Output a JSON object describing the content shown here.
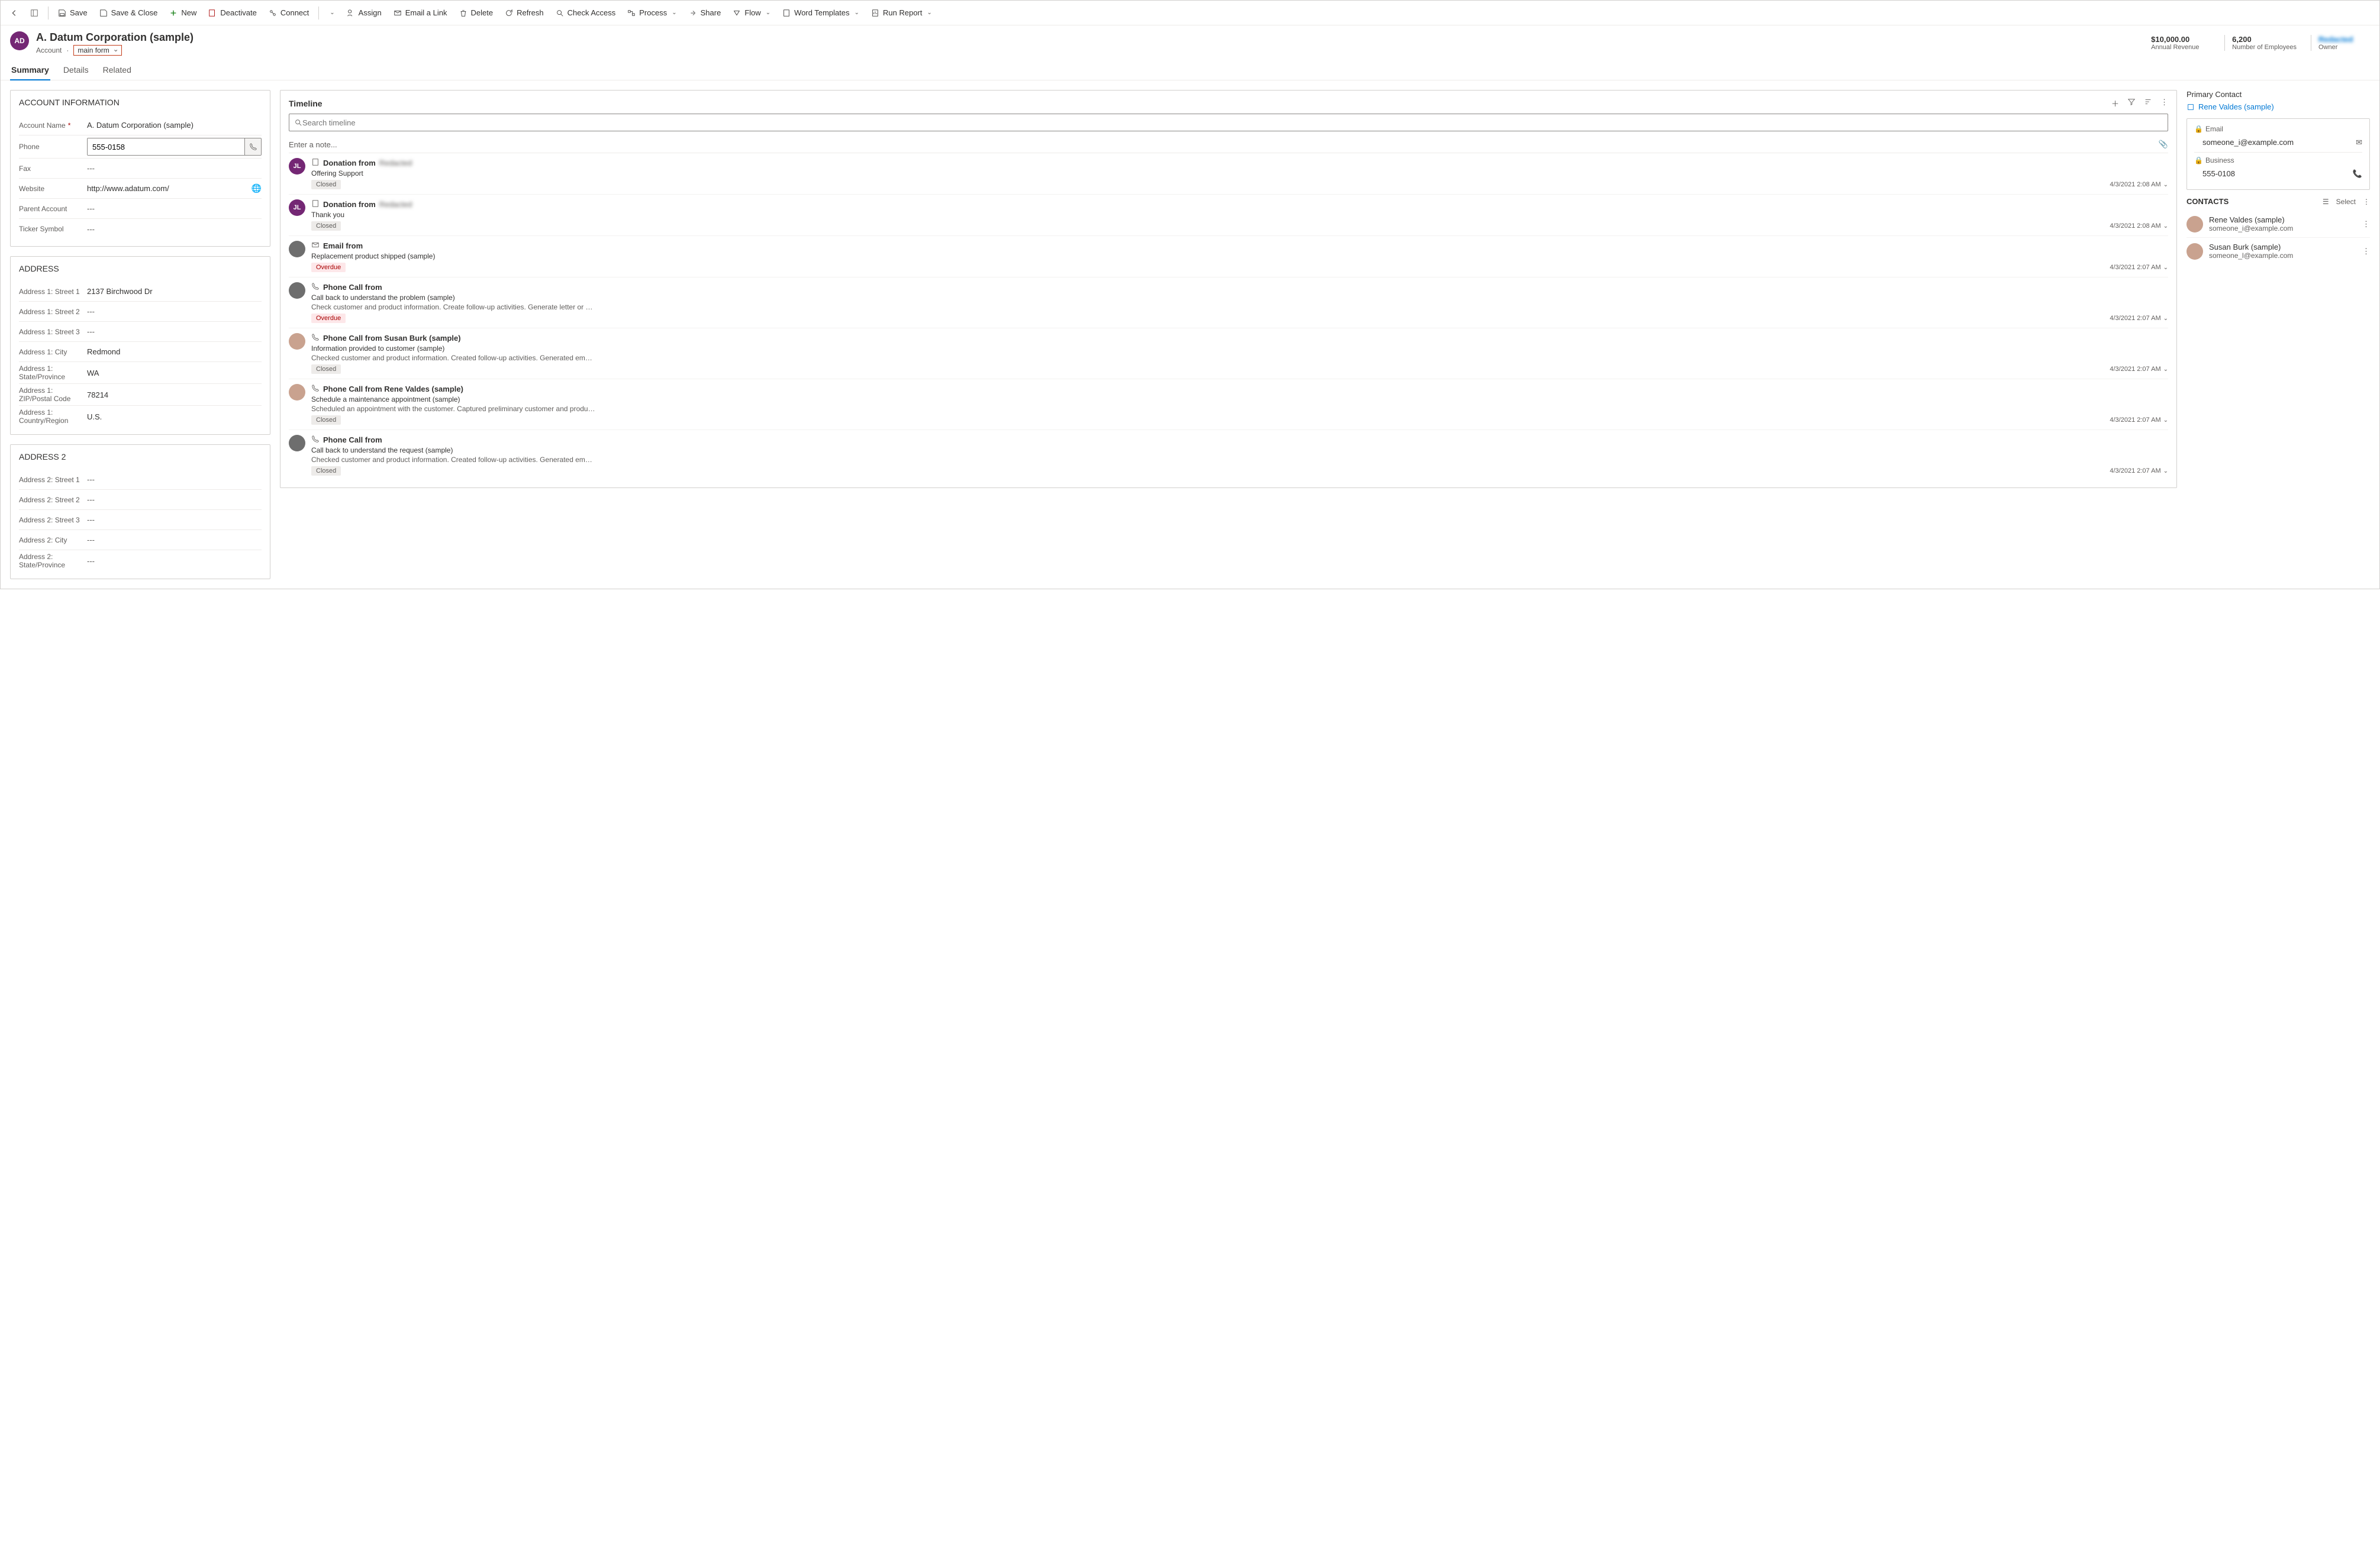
{
  "cmdbar": {
    "save": "Save",
    "save_close": "Save & Close",
    "new": "New",
    "deactivate": "Deactivate",
    "connect": "Connect",
    "assign": "Assign",
    "email_link": "Email a Link",
    "delete": "Delete",
    "refresh": "Refresh",
    "check_access": "Check Access",
    "process": "Process",
    "share": "Share",
    "flow": "Flow",
    "word_templates": "Word Templates",
    "run_report": "Run Report"
  },
  "header": {
    "avatar_initials": "AD",
    "title": "A. Datum Corporation (sample)",
    "entity": "Account",
    "form_name": "main form",
    "stats": {
      "revenue_val": "$10,000.00",
      "revenue_label": "Annual Revenue",
      "employees_val": "6,200",
      "employees_label": "Number of Employees",
      "owner_val": "Redacted",
      "owner_label": "Owner"
    }
  },
  "tabs": {
    "summary": "Summary",
    "details": "Details",
    "related": "Related"
  },
  "account_info": {
    "title": "ACCOUNT INFORMATION",
    "fields": {
      "account_name_label": "Account Name",
      "account_name_value": "A. Datum Corporation (sample)",
      "phone_label": "Phone",
      "phone_value": "555-0158",
      "fax_label": "Fax",
      "fax_value": "---",
      "website_label": "Website",
      "website_value": "http://www.adatum.com/",
      "parent_label": "Parent Account",
      "parent_value": "---",
      "ticker_label": "Ticker Symbol",
      "ticker_value": "---"
    }
  },
  "address1": {
    "title": "ADDRESS",
    "fields": [
      {
        "label": "Address 1: Street 1",
        "value": "2137 Birchwood Dr"
      },
      {
        "label": "Address 1: Street 2",
        "value": "---"
      },
      {
        "label": "Address 1: Street 3",
        "value": "---"
      },
      {
        "label": "Address 1: City",
        "value": "Redmond"
      },
      {
        "label": "Address 1: State/Province",
        "value": "WA"
      },
      {
        "label": "Address 1: ZIP/Postal Code",
        "value": "78214"
      },
      {
        "label": "Address 1: Country/Region",
        "value": "U.S."
      }
    ]
  },
  "address2": {
    "title": "ADDRESS 2",
    "fields": [
      {
        "label": "Address 2: Street 1",
        "value": "---"
      },
      {
        "label": "Address 2: Street 2",
        "value": "---"
      },
      {
        "label": "Address 2: Street 3",
        "value": "---"
      },
      {
        "label": "Address 2: City",
        "value": "---"
      },
      {
        "label": "Address 2: State/Province",
        "value": "---"
      }
    ]
  },
  "timeline": {
    "title": "Timeline",
    "search_placeholder": "Search timeline",
    "note_placeholder": "Enter a note...",
    "items": [
      {
        "avatar": "JL",
        "avatar_style": "purple",
        "kind": "Donation from",
        "kind_extra": "Redacted",
        "subject": "Offering Support",
        "desc": "",
        "status": "Closed",
        "date": "4/3/2021 2:08 AM"
      },
      {
        "avatar": "JL",
        "avatar_style": "purple",
        "kind": "Donation from",
        "kind_extra": "Redacted",
        "subject": "Thank you",
        "desc": "",
        "status": "Closed",
        "date": "4/3/2021 2:08 AM"
      },
      {
        "avatar": "",
        "avatar_style": "",
        "kind": "Email from",
        "kind_extra": "",
        "subject": "Replacement product shipped (sample)",
        "desc": "",
        "status": "Overdue",
        "date": "4/3/2021 2:07 AM"
      },
      {
        "avatar": "",
        "avatar_style": "",
        "kind": "Phone Call from",
        "kind_extra": "",
        "subject": "Call back to understand the problem (sample)",
        "desc": "Check customer and product information. Create follow-up activities. Generate letter or email using the relevant te...",
        "status": "Overdue",
        "date": "4/3/2021 2:07 AM"
      },
      {
        "avatar": "",
        "avatar_style": "img",
        "kind": "Phone Call from Susan Burk (sample)",
        "kind_extra": "",
        "subject": "Information provided to customer (sample)",
        "desc": "Checked customer and product information. Created follow-up activities. Generated email using the relevant templ...",
        "status": "Closed",
        "date": "4/3/2021 2:07 AM"
      },
      {
        "avatar": "",
        "avatar_style": "img",
        "kind": "Phone Call from Rene Valdes (sample)",
        "kind_extra": "",
        "subject": "Schedule a maintenance appointment (sample)",
        "desc": "Scheduled an appointment with the customer. Captured preliminary customer and product information. Generated ...",
        "status": "Closed",
        "date": "4/3/2021 2:07 AM"
      },
      {
        "avatar": "",
        "avatar_style": "",
        "kind": "Phone Call from",
        "kind_extra": "",
        "subject": "Call back to understand the request (sample)",
        "desc": "Checked customer and product information. Created follow-up activities. Generated email using the relevant templ...",
        "status": "Closed",
        "date": "4/3/2021 2:07 AM"
      }
    ]
  },
  "primary_contact": {
    "title": "Primary Contact",
    "name": "Rene Valdes (sample)",
    "email_label": "Email",
    "email": "someone_i@example.com",
    "business_label": "Business",
    "business": "555-0108"
  },
  "contacts": {
    "title": "CONTACTS",
    "select": "Select",
    "list": [
      {
        "name": "Rene Valdes (sample)",
        "email": "someone_i@example.com"
      },
      {
        "name": "Susan Burk (sample)",
        "email": "someone_l@example.com"
      }
    ]
  }
}
